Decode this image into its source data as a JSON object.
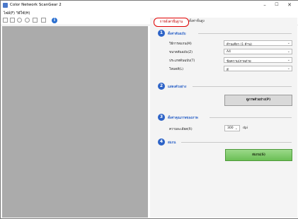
{
  "window": {
    "title": "Color Network ScanGear 2"
  },
  "menu": [
    "ไฟล์(F)",
    "วิธีใช้(H)"
  ],
  "toolbar": {
    "icons": [
      "new-icon",
      "open-icon",
      "zoom-icon",
      "zoom-out-icon",
      "crop-icon",
      "copy-icon",
      "info-icon"
    ]
  },
  "tabs": {
    "basic": "การตั้งค่าพื้นฐาน",
    "advanced": "ตั้งค่าขั้นสูง"
  },
  "sections": [
    {
      "num": "1",
      "title": "ตั้งค่าต้นฉบับ"
    },
    {
      "num": "2",
      "title": "แสดงตัวอย่าง"
    },
    {
      "num": "3",
      "title": "ตั้งค่าคุณภาพของภาพ"
    },
    {
      "num": "4",
      "title": "สแกน"
    }
  ],
  "fields": [
    {
      "label": "วิธีการสแกน(M)",
      "value": "ด้านเดียว (1 ด้าน)"
    },
    {
      "label": "ขนาดต้นฉบับ(Z)",
      "value": "A4"
    },
    {
      "label": "ประเภทต้นฉบับ(T)",
      "value": "ข้อความ/ภาพถ่าย"
    },
    {
      "label": "โหมดสี(L)",
      "value": "สี"
    }
  ],
  "preview_button": "ดูภาพตัวอย่าง(P)",
  "resolution": {
    "label": "ความละเอียด(R)",
    "value": "300",
    "unit": "dpi"
  },
  "scan_button": "สแกน(S)",
  "colors": {
    "accent": "#2d63c7",
    "scan": "#6bbf55",
    "highlight": "#e00000"
  }
}
